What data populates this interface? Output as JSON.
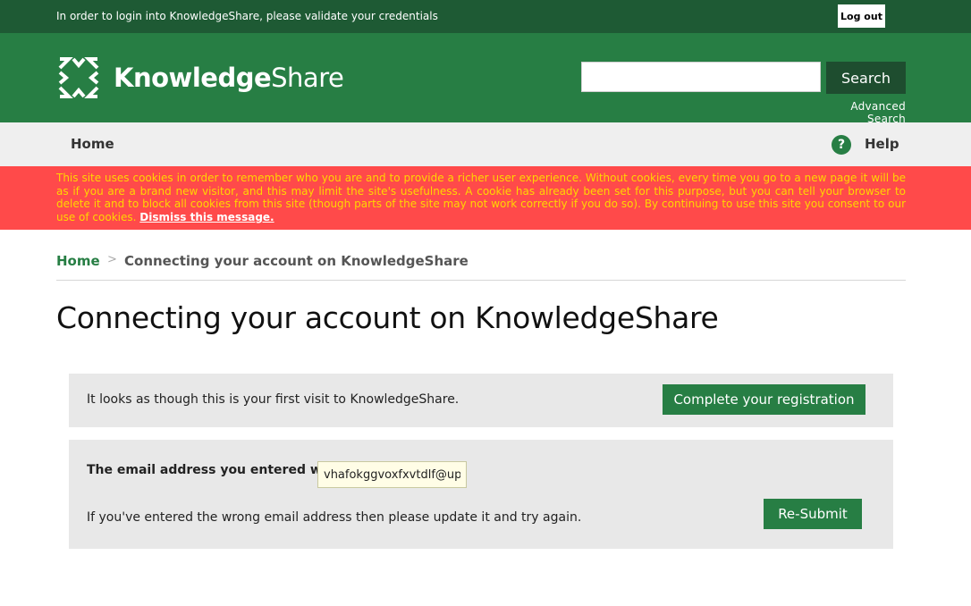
{
  "topbar": {
    "notice": "In order to login into KnowledgeShare, please validate your credentials",
    "logout_label": "Log out"
  },
  "header": {
    "logo_bold": "Knowledge",
    "logo_light": "Share",
    "search_value": "",
    "search_button": "Search",
    "advanced_search": "Advanced Search"
  },
  "nav": {
    "home": "Home",
    "help_icon": "?",
    "help": "Help"
  },
  "cookie": {
    "message": "This site uses cookies in order to remember who you are and to provide a richer user experience. Without cookies, every time you go to a new page it will be as if you are a brand new visitor, and this may limit the site's usefulness. A cookie has already been set for this purpose, but you can tell your browser to delete it and to block all cookies from this site (though parts of the site may not work correctly if you do so). By continuing to use this site you consent to our use of cookies.",
    "dismiss": "Dismiss this message."
  },
  "breadcrumb": {
    "home": "Home",
    "separator": ">",
    "current": "Connecting your account on KnowledgeShare"
  },
  "page_title": "Connecting your account on KnowledgeShare",
  "registration": {
    "message": "It looks as though this is your first visit to KnowledgeShare.",
    "button": "Complete your registration"
  },
  "email": {
    "label": "The email address you entered was:",
    "value": "vhafokggvoxfxvtdlf@upi",
    "hint": "If you've entered the wrong email address then please update it and try again.",
    "button": "Re-Submit"
  },
  "colors": {
    "topbar": "#1e5a34",
    "header": "#277e44",
    "cookie_bg": "#ff4a4a",
    "cookie_text": "#ffd600",
    "nav_bg": "#efefef",
    "panel_bg": "#e8e8e8"
  }
}
